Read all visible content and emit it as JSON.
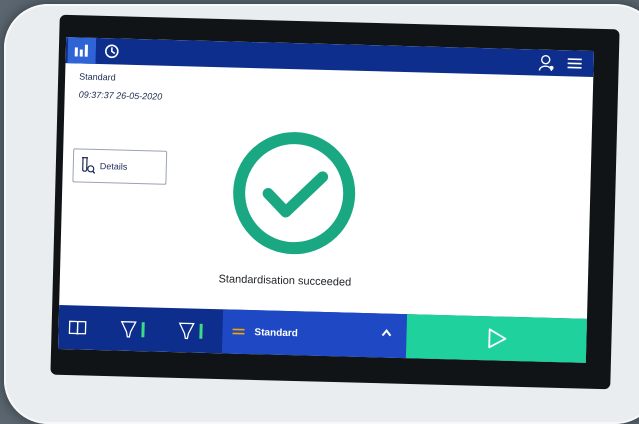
{
  "header": {
    "tabs": [
      {
        "name": "results",
        "icon": "bar-chart-icon",
        "active": true
      },
      {
        "name": "history",
        "icon": "history-icon",
        "active": false
      }
    ],
    "icons": {
      "user": "user-settings-icon",
      "menu": "hamburger-menu-icon"
    }
  },
  "info": {
    "method_name": "Standard",
    "timestamp": "09:37:37 26-05-2020"
  },
  "details_button": {
    "label": "Details",
    "icon": "tube-search-icon"
  },
  "status": {
    "message": "Standardisation succeeded",
    "icon": "checkmark-circle-icon",
    "color": "#1aa883"
  },
  "bottombar": {
    "icons": [
      "book-icon",
      "cup-icon",
      "cup-icon"
    ],
    "selector": {
      "label": "Standard",
      "icon": "list-icon",
      "caret": "chevron-up-icon"
    },
    "start": {
      "icon": "play-icon",
      "color": "#1fd19c"
    }
  },
  "colors": {
    "primary": "#0d2e8c",
    "accent": "#2e64d6",
    "success": "#1aa883"
  }
}
